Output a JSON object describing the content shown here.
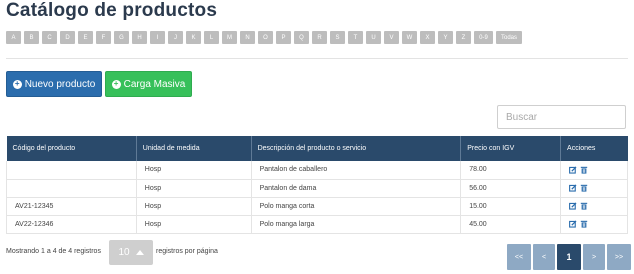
{
  "page": {
    "title": "Catálogo de productos"
  },
  "alphabet": [
    "A",
    "B",
    "C",
    "D",
    "E",
    "F",
    "G",
    "H",
    "I",
    "J",
    "K",
    "L",
    "M",
    "N",
    "O",
    "P",
    "Q",
    "R",
    "S",
    "T",
    "U",
    "V",
    "W",
    "X",
    "Y",
    "Z",
    "0-9",
    "Todas"
  ],
  "toolbar": {
    "new_label": "Nuevo producto",
    "mass_label": "Carga Masiva"
  },
  "search": {
    "placeholder": "Buscar",
    "value": ""
  },
  "table": {
    "headers": [
      "Código del producto",
      "Unidad de medida",
      "Descripción del producto o servicio",
      "Precio con IGV",
      "Acciones"
    ],
    "rows": [
      {
        "code": "",
        "unit": "Hosp",
        "description": "Pantalon de caballero",
        "price": "78.00"
      },
      {
        "code": "",
        "unit": "Hosp",
        "description": "Pantalon de dama",
        "price": "56.00"
      },
      {
        "code": "AV21-12345",
        "unit": "Hosp",
        "description": "Polo manga corta",
        "price": "15.00"
      },
      {
        "code": "AV22-12346",
        "unit": "Hosp",
        "description": "Polo manga larga",
        "price": "45.00"
      }
    ]
  },
  "footer": {
    "showing": "Mostrando 1 a 4 de 4 registros",
    "per_page_value": "10",
    "per_page_label": "registros por página"
  },
  "pager": {
    "first": "<<",
    "prev": "<",
    "current": "1",
    "next": ">",
    "last": ">>"
  },
  "colors": {
    "header": "#2a4a6b",
    "primary": "#2b6dad",
    "success": "#37c05a",
    "action_icon": "#2b6dad"
  },
  "icons": {
    "row_actions": [
      "edit-icon",
      "trash-icon"
    ],
    "new_button": "plus-circle-icon",
    "mass_button": "plus-circle-icon"
  }
}
